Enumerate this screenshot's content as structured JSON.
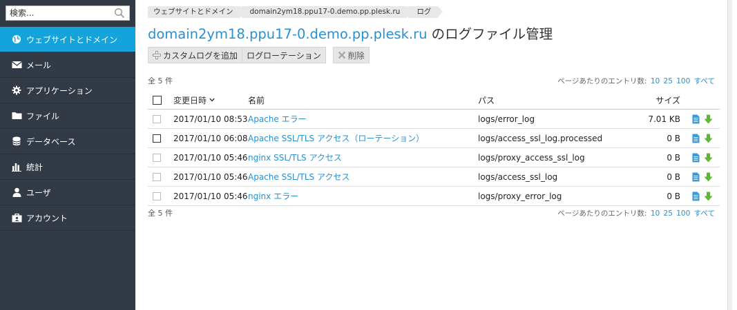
{
  "search": {
    "placeholder": "検索..."
  },
  "sidebar": {
    "items": [
      {
        "label": "ウェブサイトとドメイン",
        "icon": "globe-icon",
        "active": true
      },
      {
        "label": "メール",
        "icon": "envelope-icon"
      },
      {
        "label": "アプリケーション",
        "icon": "gear-icon"
      },
      {
        "label": "ファイル",
        "icon": "folder-icon"
      },
      {
        "label": "データベース",
        "icon": "database-icon"
      },
      {
        "label": "統計",
        "icon": "bar-chart-icon"
      },
      {
        "label": "ユーザ",
        "icon": "user-icon"
      },
      {
        "label": "アカウント",
        "icon": "account-icon"
      }
    ]
  },
  "breadcrumb": [
    "ウェブサイトとドメイン",
    "domain2ym18.ppu17-0.demo.pp.plesk.ru",
    "ログ"
  ],
  "page": {
    "title_domain": "domain2ym18.ppu17-0.demo.pp.plesk.ru",
    "title_suffix": " のログファイル管理"
  },
  "toolbar": {
    "add_custom_log": "カスタムログを追加",
    "log_rotation": "ログローテーション",
    "delete": "削除"
  },
  "list": {
    "count_text": "全 5 件",
    "perpage_label": "ページあたりのエントリ数:",
    "perpage_options": [
      "10",
      "25",
      "100",
      "すべて"
    ],
    "columns": {
      "modified": "変更日時",
      "name": "名前",
      "path": "パス",
      "size": "サイズ"
    },
    "rows": [
      {
        "date": "2017/01/10 08:53",
        "name": "Apache エラー",
        "path": "logs/error_log",
        "size": "7.01 KB"
      },
      {
        "date": "2017/01/10 06:08",
        "name": "Apache SSL/TLS アクセス（ローテーション）",
        "path": "logs/access_ssl_log.processed",
        "size": "0 B"
      },
      {
        "date": "2017/01/10 05:46",
        "name": "nginx SSL/TLS アクセス",
        "path": "logs/proxy_access_ssl_log",
        "size": "0 B"
      },
      {
        "date": "2017/01/10 05:46",
        "name": "Apache SSL/TLS アクセス",
        "path": "logs/access_ssl_log",
        "size": "0 B"
      },
      {
        "date": "2017/01/10 05:46",
        "name": "nginx エラー",
        "path": "logs/proxy_error_log",
        "size": "0 B"
      }
    ]
  },
  "colors": {
    "accent": "#15a3dc",
    "link": "#2a8fd0",
    "sidebar_bg": "#323a45",
    "download_green": "#5cb82c",
    "file_blue": "#3b9bd8"
  }
}
